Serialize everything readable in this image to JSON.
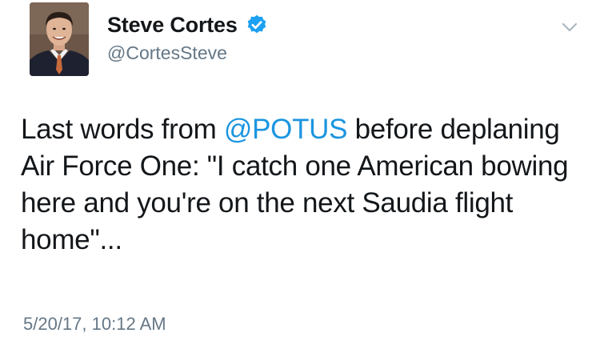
{
  "author": {
    "display_name": "Steve Cortes",
    "handle": "@CortesSteve",
    "verified": true,
    "avatar_icon": "profile-photo"
  },
  "tweet": {
    "text_before": "Last words from ",
    "mention": "@POTUS",
    "text_after": " before deplaning Air Force One: \"I catch one American bowing here and you're on the next Saudia flight home\"...",
    "timestamp": "5/20/17, 10:12 AM"
  },
  "icons": {
    "verified": "verified-badge-icon",
    "menu": "chevron-down-icon"
  },
  "colors": {
    "text": "#14171a",
    "secondary": "#657786",
    "link": "#1b95e0",
    "verified": "#1da1f2"
  }
}
